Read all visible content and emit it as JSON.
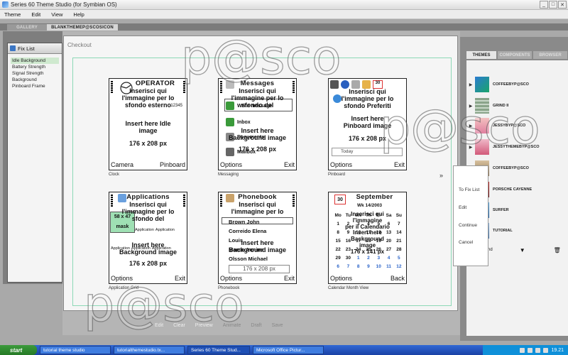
{
  "window": {
    "title": "Series 60 Theme Studio (for Symbian OS)",
    "controls": [
      "_",
      "□",
      "✕"
    ]
  },
  "menubar": [
    "Theme",
    "Edit",
    "View",
    "Help"
  ],
  "top_tabs": {
    "inactive": "GALLERY",
    "active": "BLANKTHEMEP@SCOSICON"
  },
  "fix_list": {
    "title": "Fix List",
    "items": [
      "Idle Background",
      "Battery Strength",
      "Signal Strength",
      "Background",
      "Pinboard Frame"
    ]
  },
  "checkout": {
    "title": "Checkout"
  },
  "phones": {
    "clock": {
      "title": "OPERATOR",
      "body": [
        "Inserisci qui",
        "l'immagine per lo",
        "sfondo esterno"
      ],
      "en": [
        "Insert here Idle",
        "image"
      ],
      "size": "176 x 208 px",
      "left": "Camera",
      "right": "Pinboard",
      "caption": "Clock",
      "clock_num": "12345"
    },
    "messaging": {
      "title": "Messages",
      "body": [
        "Inserisci qui",
        "l'immagine per lo",
        "sfondo del"
      ],
      "items": [
        "Write message",
        "Inbox",
        "Documents",
        "Mailbox"
      ],
      "en": [
        "Insert here",
        "Background image"
      ],
      "size": "176 x 208 px",
      "left": "Options",
      "right": "Exit",
      "caption": "Messaging"
    },
    "pinboard": {
      "body": [
        "Inserisci qui",
        "l'immagine per lo",
        "sfondo Preferiti"
      ],
      "en": [
        "Insert here",
        "Pinboard image"
      ],
      "size": "176 x 208 px",
      "today": "Today",
      "left": "Options",
      "right": "Exit",
      "caption": "Pinboard",
      "cal_num": "30"
    },
    "app_grid": {
      "title": "Applications",
      "body": [
        "Inserisci qui",
        "l'immagine per lo",
        "sfondo del"
      ],
      "labels": [
        "Application",
        "Application",
        "Application"
      ],
      "en": [
        "Insert here",
        "Background image"
      ],
      "size": "176 x 208 px",
      "left": "Options",
      "right": "Exit",
      "caption": "Application Grid",
      "mask": "mask",
      "num": "58 x 47"
    },
    "phonebook": {
      "title": "Phonebook",
      "body": [
        "Inserisci qui",
        "l'immagine per lo"
      ],
      "items": [
        "Brown John",
        "Correido Elena",
        "Louis",
        "Marco Annine",
        "Olsson Michael"
      ],
      "en": [
        "Insert here",
        "Background image"
      ],
      "size": "176 x 208 px",
      "left": "Options",
      "right": "Exit",
      "caption": "Phonebook"
    },
    "calendar": {
      "title": "September",
      "sub": "Inserisci qui",
      "body": [
        "l'immagine",
        "per il Calendario"
      ],
      "en": [
        "Insert here",
        "Background",
        "image"
      ],
      "size": "176 x 141 px",
      "week": "Wk 14/2003",
      "day_head": [
        "Mo",
        "Tu",
        "We",
        "Th",
        "Fr",
        "Sa",
        "Su"
      ],
      "days": [
        "1",
        "2",
        "3",
        "4",
        "5",
        "6",
        "7",
        "8",
        "9",
        "10",
        "11",
        "12",
        "13",
        "14",
        "15",
        "16",
        "17",
        "18",
        "19",
        "20",
        "21",
        "22",
        "23",
        "24",
        "25",
        "26",
        "27",
        "28",
        "29",
        "30",
        "1",
        "2",
        "3",
        "4",
        "5",
        "6",
        "7",
        "8",
        "9",
        "10",
        "11",
        "12"
      ],
      "left": "Options",
      "right": "Back",
      "caption": "Calendar Month View",
      "day_num": "30"
    }
  },
  "bottom_tools": {
    "items": [
      "Edit",
      "Clear",
      "Preview",
      "Animate",
      "Draft",
      "Save"
    ]
  },
  "context_menu": {
    "items": [
      "To Fix List",
      "Edit",
      "Continue",
      "Cancel"
    ]
  },
  "right_tabs": [
    "THEMES",
    "COMPONENTS",
    "BROWSER"
  ],
  "themes": [
    "COFFEEBYP@SCO",
    "GRIND II",
    "JESSYBYP@SCO",
    "JESSYTHEMEBYP@SCO",
    "COFFEEBYP@SCO",
    "PORSCHE CAYENNE",
    "SURFER",
    "TUTORIAL"
  ],
  "theme_footer": "nd",
  "taskbar": {
    "start": "start",
    "tasks": [
      "tutorial theme studio",
      "tutorialthemestudio.tx...",
      "Series 60 Theme Stud...",
      "Microsoft Office Pictur..."
    ],
    "time": "19.21"
  },
  "watermark": "p@sco",
  "arrow": "»"
}
